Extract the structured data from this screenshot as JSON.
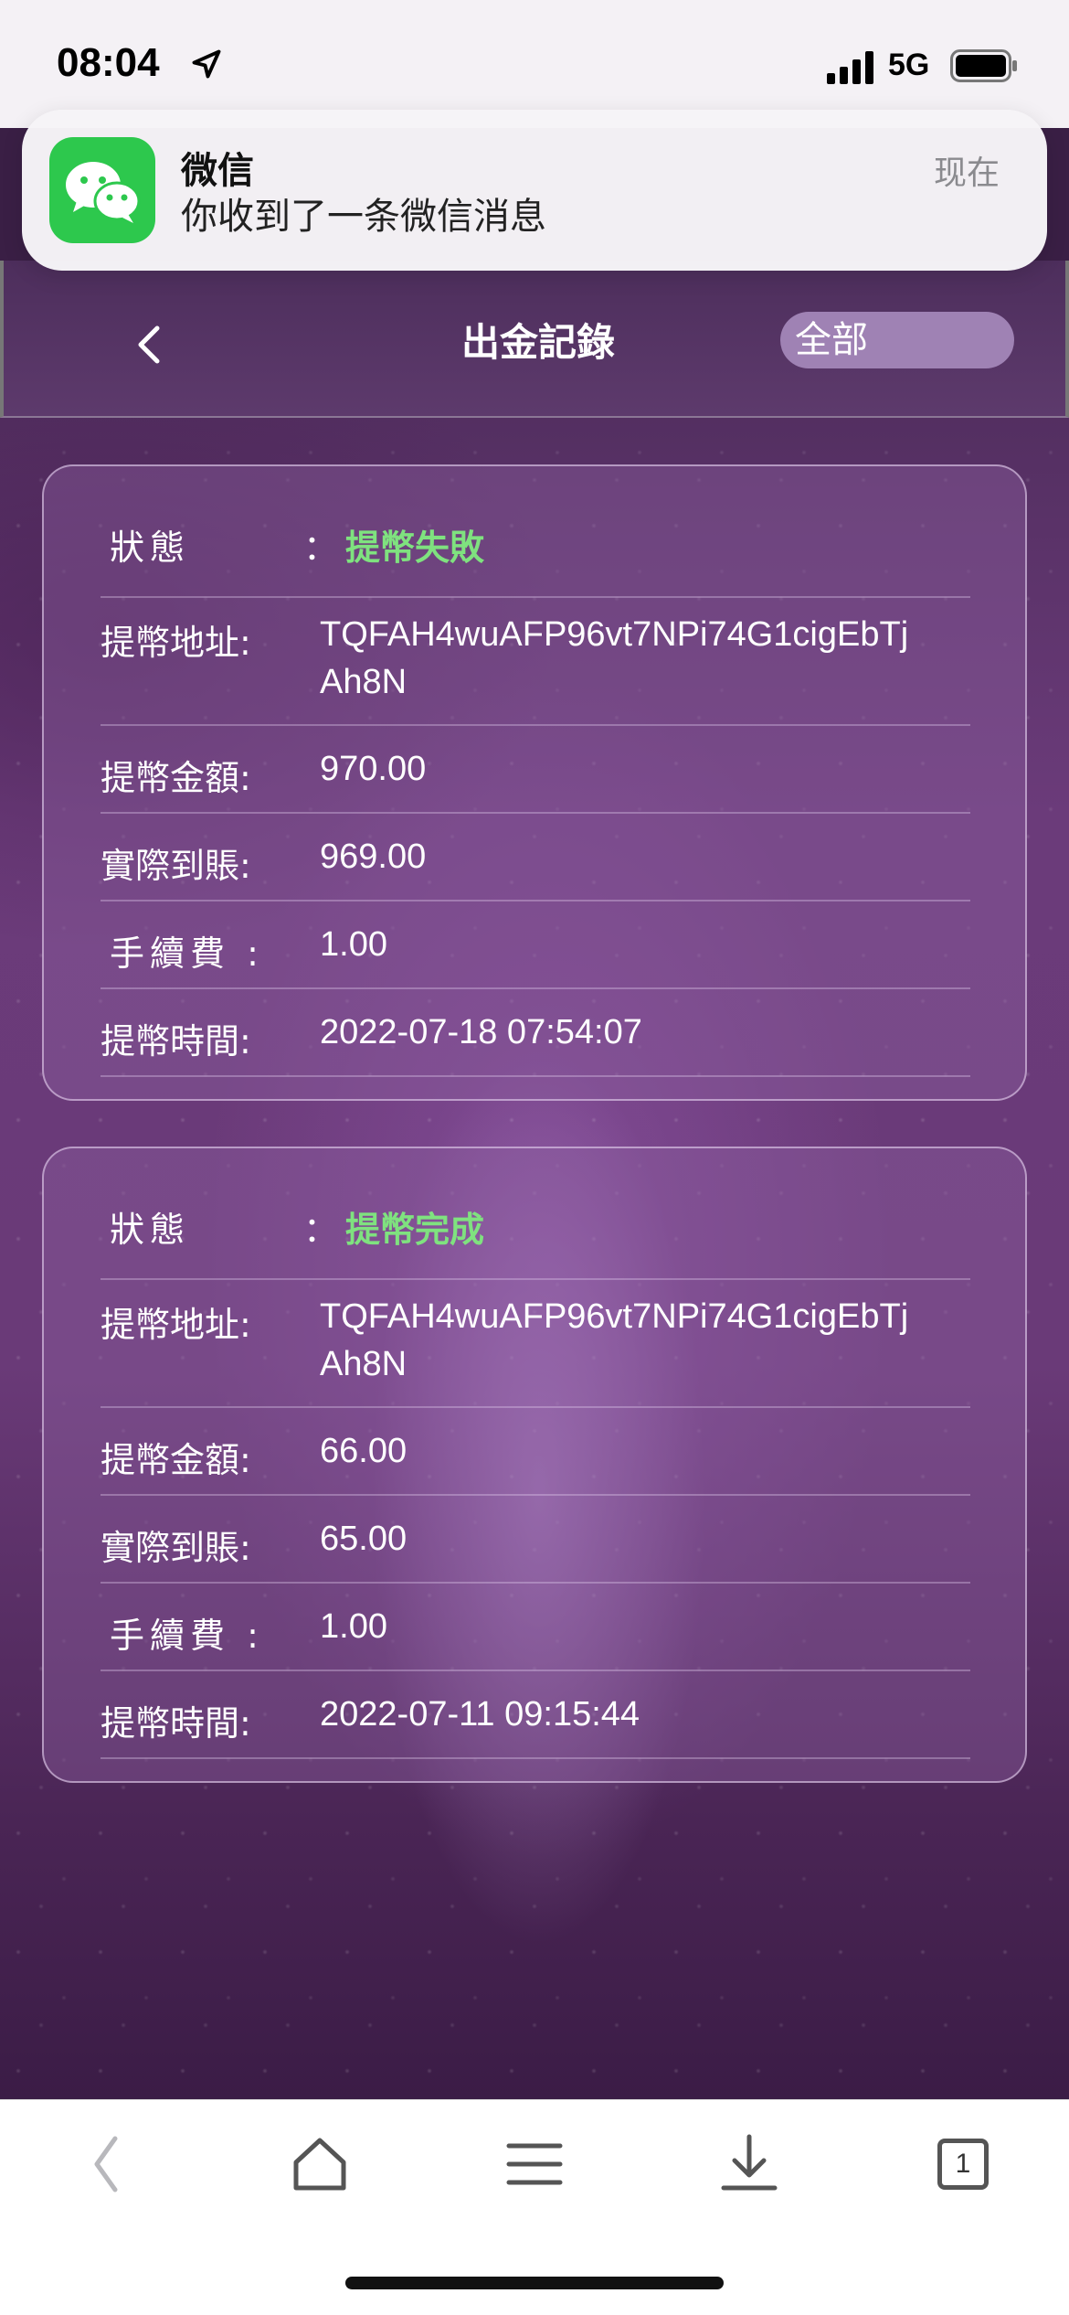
{
  "status_bar": {
    "time": "08:04",
    "network": "5G"
  },
  "notification": {
    "app_name": "微信",
    "message": "你收到了一条微信消息",
    "time": "现在",
    "icon": "wechat-icon"
  },
  "header": {
    "title": "出金記錄",
    "filter_value": "全部"
  },
  "records": [
    {
      "status_label": "狀態",
      "status_sep": "：",
      "status": "提幣失敗",
      "address_label": "提幣地址:",
      "address": "TQFAH4wuAFP96vt7NPi74G1cigEbTjAh8N",
      "amount_label": "提幣金額:",
      "amount": "970.00",
      "received_label": "實際到賬:",
      "received": "969.00",
      "fee_label": "手續費 :",
      "fee": "1.00",
      "time_label": "提幣時間:",
      "time": "2022-07-18 07:54:07"
    },
    {
      "status_label": "狀態",
      "status_sep": "：",
      "status": "提幣完成",
      "address_label": "提幣地址:",
      "address": "TQFAH4wuAFP96vt7NPi74G1cigEbTjAh8N",
      "amount_label": "提幣金額:",
      "amount": "66.00",
      "received_label": "實際到賬:",
      "received": "65.00",
      "fee_label": "手續費 :",
      "fee": "1.00",
      "time_label": "提幣時間:",
      "time": "2022-07-11 09:15:44"
    }
  ],
  "browser_bar": {
    "tab_count": "1",
    "icons": [
      "back-icon",
      "home-icon",
      "menu-icon",
      "download-icon",
      "tabs-icon"
    ]
  },
  "colors": {
    "status_green": "#7fe27f",
    "wechat_green": "#2dc84d",
    "filter_bg": "#9f82b4"
  }
}
